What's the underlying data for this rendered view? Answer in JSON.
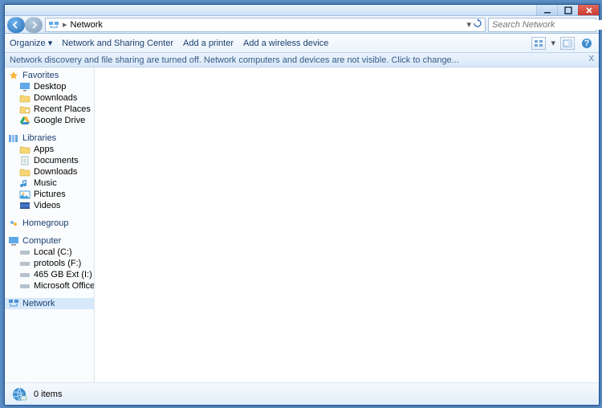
{
  "window": {
    "location": "Network",
    "search_placeholder": "Search Network"
  },
  "toolbar": {
    "organize": "Organize ▾",
    "nsc": "Network and Sharing Center",
    "add_printer": "Add a printer",
    "add_wireless": "Add a wireless device"
  },
  "infobar": {
    "text": "Network discovery and file sharing are turned off. Network computers and devices are not visible. Click to change...",
    "close": "X"
  },
  "tree": {
    "favorites": {
      "label": "Favorites",
      "items": [
        "Desktop",
        "Downloads",
        "Recent Places",
        "Google Drive"
      ]
    },
    "libraries": {
      "label": "Libraries",
      "items": [
        "Apps",
        "Documents",
        "Downloads",
        "Music",
        "Pictures",
        "Videos"
      ]
    },
    "homegroup": {
      "label": "Homegroup"
    },
    "computer": {
      "label": "Computer",
      "items": [
        "Local (C:)",
        "protools (F:)",
        "465 GB Ext (I:)",
        "Microsoft Office Click-to-R"
      ]
    },
    "network": {
      "label": "Network"
    }
  },
  "status": {
    "items_text": "0 items"
  }
}
